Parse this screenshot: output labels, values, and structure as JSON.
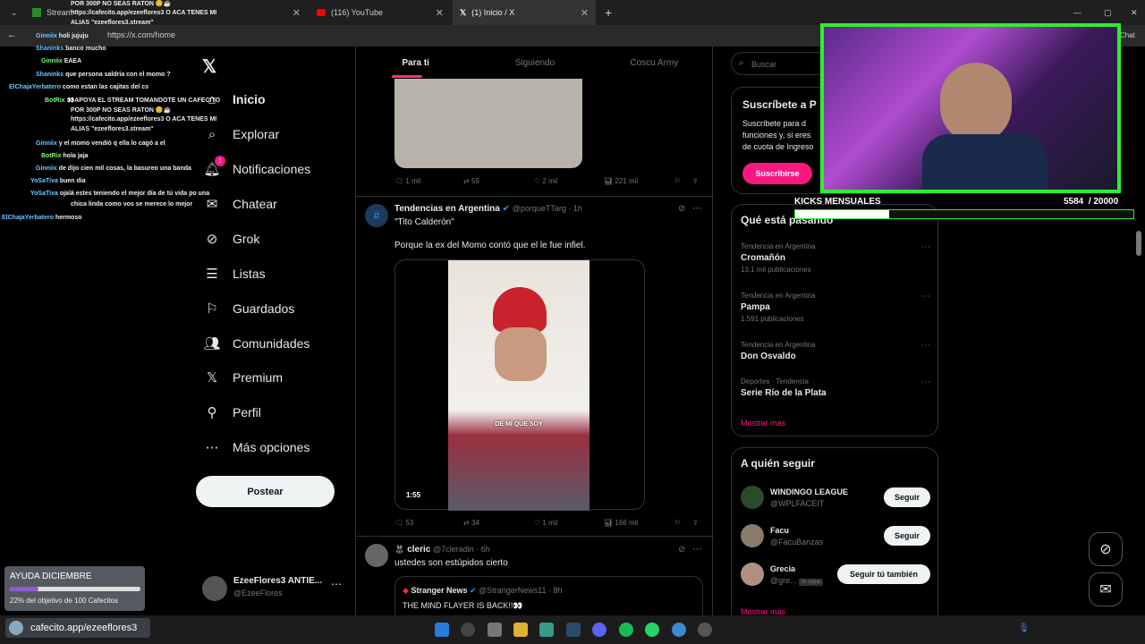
{
  "browser": {
    "tabs": [
      {
        "label": "Stream",
        "active": false
      },
      {
        "label": "(116) YouTube",
        "active": false
      },
      {
        "label": "(1) Inicio / X",
        "active": true
      }
    ],
    "url": "https://x.com/home",
    "right_chat": "Chat"
  },
  "nav": {
    "items": [
      {
        "label": "Inicio",
        "icon": "home-icon"
      },
      {
        "label": "Explorar",
        "icon": "search-icon"
      },
      {
        "label": "Notificaciones",
        "icon": "bell-icon",
        "badge": "1"
      },
      {
        "label": "Chatear",
        "icon": "mail-icon"
      },
      {
        "label": "Grok",
        "icon": "grok-icon"
      },
      {
        "label": "Listas",
        "icon": "list-icon"
      },
      {
        "label": "Guardados",
        "icon": "bookmark-icon"
      },
      {
        "label": "Comunidades",
        "icon": "people-icon"
      },
      {
        "label": "Premium",
        "icon": "x-icon"
      },
      {
        "label": "Perfil",
        "icon": "person-icon"
      },
      {
        "label": "Más opciones",
        "icon": "more-circle-icon"
      }
    ],
    "post_button": "Postear",
    "account": {
      "name": "EzeeFlores3 ANTIE...",
      "handle": "@EzeeFlores"
    }
  },
  "feed": {
    "tabs": [
      "Para ti",
      "Siguiendo",
      "Coscu Army"
    ],
    "post1_actions": {
      "reply": "1 mil",
      "repost": "59",
      "like": "2 mil",
      "views": "221 mil"
    },
    "post2": {
      "name": "Tendencias en Argentina",
      "handle": "@porqueTTarg · 1h",
      "quote": "\"Tito Calderón\"",
      "text": "Porque la ex del Momo contó que el le fue infiel.",
      "video_caption": "DE MÍ QUE SOY",
      "duration": "1:55",
      "actions": {
        "reply": "53",
        "repost": "34",
        "like": "1 mil",
        "views": "166 mil"
      }
    },
    "post3": {
      "name": "cleric",
      "handle": "@7cleradin · 6h",
      "text": "ustedes son estúpidos cierto",
      "quoted": {
        "name": "Stranger News",
        "handle": "@StrangerNews11 · 8h",
        "text": "THE MIND FLAYER IS BACK!!👀"
      }
    }
  },
  "sidebar": {
    "search_placeholder": "Buscar",
    "premium": {
      "title": "Suscríbete a P",
      "body": "Suscríbete para d\nfunciones y, si eres\nde cuota de Ingreso",
      "button": "Suscribirse"
    },
    "trends_title": "Qué está pasando",
    "trends": [
      {
        "cat": "Tendencia en Argentina",
        "name": "Cromañón",
        "count": "13,1 mil publicaciones"
      },
      {
        "cat": "Tendencia en Argentina",
        "name": "Pampa",
        "count": "1.591 publicaciones"
      },
      {
        "cat": "Tendencia en Argentina",
        "name": "Don Osvaldo",
        "count": ""
      },
      {
        "cat": "Deportes · Tendencia",
        "name": "Serie Río de la Plata",
        "count": ""
      }
    ],
    "show_more": "Mostrar más",
    "follow_title": "A quién seguir",
    "follow": [
      {
        "name": "WINDINGO LEAGUE",
        "handle": "@WPLFACEIT",
        "button": "Seguir",
        "tag": ""
      },
      {
        "name": "Facu",
        "handle": "@FacuBanzas",
        "button": "Seguir",
        "tag": ""
      },
      {
        "name": "Grecia",
        "handle": "@gre...",
        "button": "Seguir tú también",
        "tag": "Te sigue"
      }
    ],
    "show_more2": "Mostrar más"
  },
  "overlay": {
    "kicks_label": "KICKS MENSUALES",
    "kicks_value": "5584",
    "kicks_goal": "/ 20000",
    "kicks_progress": 0.279,
    "goal_title": "AYUDA DICIEMBRE",
    "goal_text": "22% del objetivo de 100 Cafecitos",
    "goal_progress": 0.22,
    "cafecito": "cafecito.app/ezeeflores3",
    "chat": [
      {
        "user": "",
        "msg": "POR 300P NO SEAS RATON 😊☕"
      },
      {
        "user": "",
        "msg": "https://cafecito.app/ezeeflores3 O ACA TENES MI"
      },
      {
        "user": "",
        "msg": "ALIAS \"ezeeflores3.stream\""
      },
      {
        "user": "Ginniix",
        "msg": "holi jujuju"
      },
      {
        "user": "Shaninks",
        "msg": "banco mucho"
      },
      {
        "user": "Ginniix",
        "msg": "EAEA"
      },
      {
        "user": "Shaninks",
        "msg": "que persona saldria con el momo ?"
      },
      {
        "user": "ElChajaYerbatero",
        "msg": "como estan las cajitas del cs"
      },
      {
        "user": "BotRix",
        "msg": "👀APOYA EL STREAM TOMANDOTE UN CAFECITO"
      },
      {
        "user": "",
        "msg": "POR 300P NO SEAS RATON 😊☕"
      },
      {
        "user": "",
        "msg": "https://cafecito.app/ezeeflores3 O ACA TENES MI"
      },
      {
        "user": "",
        "msg": "ALIAS \"ezeeflores3.stream\""
      },
      {
        "user": "Ginniix",
        "msg": "y el momo vendió q ella lo cagó a el"
      },
      {
        "user": "BotRix",
        "msg": "hola jaja"
      },
      {
        "user": "Ginniix",
        "msg": "de dijo cien mil cosas, la basureo una banda"
      },
      {
        "user": "YoSaTiva",
        "msg": "buen dia"
      },
      {
        "user": "YoSaTiva",
        "msg": "ojalá estes teniendo el mejor día de tú vida po una"
      },
      {
        "user": "",
        "msg": "chica linda como vos se merece lo mejor"
      },
      {
        "user": "ElChajaYerbatero",
        "msg": "hermoso"
      }
    ]
  },
  "colors": {
    "accent": "#f91880",
    "x_bg": "#000000",
    "border": "#2f3336",
    "kick_green": "#2ef02e"
  }
}
